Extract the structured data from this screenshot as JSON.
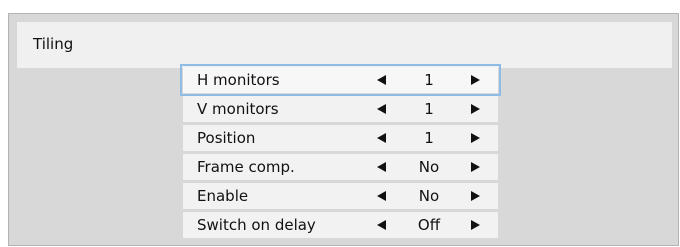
{
  "window": {
    "title": "Tiling"
  },
  "menu": {
    "items": [
      {
        "label": "H monitors",
        "value": "1",
        "selected": true
      },
      {
        "label": "V monitors",
        "value": "1"
      },
      {
        "label": "Position",
        "value": "1"
      },
      {
        "label": "Frame comp.",
        "value": "No"
      },
      {
        "label": "Enable",
        "value": "No"
      },
      {
        "label": "Switch on delay",
        "value": "Off"
      }
    ],
    "icons": {
      "decrease": "left-arrow-icon",
      "increase": "right-arrow-icon"
    }
  }
}
